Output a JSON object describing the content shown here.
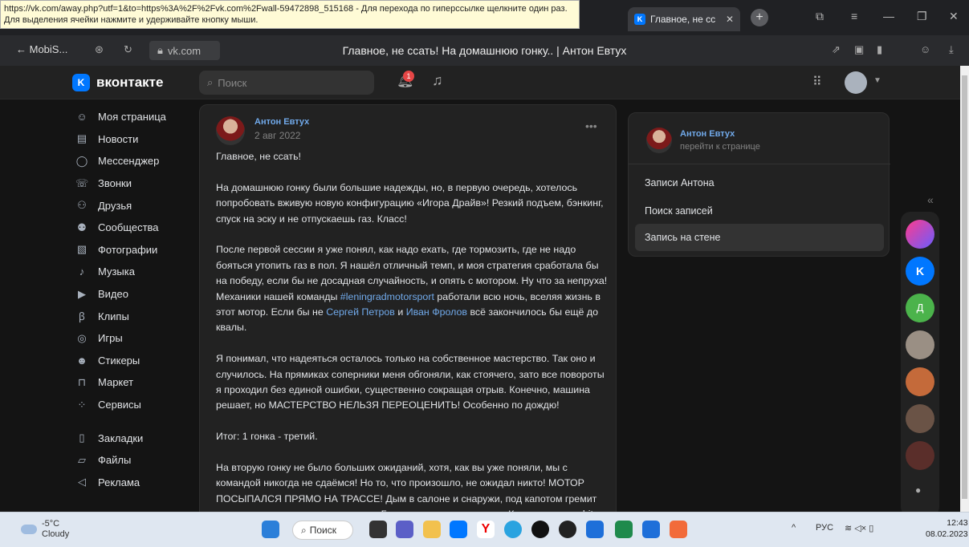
{
  "tooltip": {
    "line1": "https://vk.com/away.php?utf=1&to=https%3A%2F%2Fvk.com%2Fwall-59472898_515168 - Для перехода по гиперссылке щелкните один раз.",
    "line2": "Для выделения ячейки нажмите и удерживайте кнопку мыши."
  },
  "browser": {
    "tab_title": "Главное, не сс",
    "back_label": "MobiS...",
    "url": "vk.com",
    "page_title": "Главное, не ссать! На домашнюю гонку.. | Антон Евтух"
  },
  "vk": {
    "logo": "вконтакте",
    "search_placeholder": "Поиск",
    "notif_count": "1"
  },
  "sidebar": {
    "items": [
      {
        "label": "Моя страница",
        "icon": "user-circle-icon"
      },
      {
        "label": "Новости",
        "icon": "newspaper-icon"
      },
      {
        "label": "Мессенджер",
        "icon": "chat-icon"
      },
      {
        "label": "Звонки",
        "icon": "phone-icon"
      },
      {
        "label": "Друзья",
        "icon": "friends-icon"
      },
      {
        "label": "Сообщества",
        "icon": "groups-icon"
      },
      {
        "label": "Фотографии",
        "icon": "photo-icon"
      },
      {
        "label": "Музыка",
        "icon": "music-icon"
      },
      {
        "label": "Видео",
        "icon": "video-icon"
      },
      {
        "label": "Клипы",
        "icon": "clips-icon"
      },
      {
        "label": "Игры",
        "icon": "gamepad-icon"
      },
      {
        "label": "Стикеры",
        "icon": "sticker-icon"
      },
      {
        "label": "Маркет",
        "icon": "bag-icon"
      },
      {
        "label": "Сервисы",
        "icon": "services-icon"
      }
    ],
    "items2": [
      {
        "label": "Закладки",
        "icon": "bookmark-icon"
      },
      {
        "label": "Файлы",
        "icon": "file-icon"
      },
      {
        "label": "Реклама",
        "icon": "megaphone-icon"
      }
    ]
  },
  "post": {
    "author": "Антон Евтух",
    "date": "2 авг 2022",
    "p1": "Главное, не ссать!",
    "p2": "На домашнюю гонку были большие надежды, но, в первую очередь, хотелось попробовать вживую новую конфигурацию «Игора Драйв»! Резкий подъем, бэнкинг, спуск на эску и не отпускаешь газ. Класс!",
    "p3a": "После первой сессии я уже понял, как надо ехать, где тормозить, где не надо бояться утопить газ в пол. Я нашёл отличный темп, и моя стратегия сработала бы на победу, если бы не досадная случайность, и опять с мотором. Ну что за непруха! Механики нашей команды ",
    "p3link": "#leningradmotorsport",
    "p3b": " работали всю ночь, вселяя жизнь в этот мотор. Если бы не ",
    "p3link2": "Сергей Петров",
    "p3c": " и ",
    "p3link3": "Иван Фролов",
    "p3d": " всё закончилось бы ещё до квалы.",
    "p4": "Я понимал, что надеяться осталось только на собственное мастерство. Так оно и случилось. На прямиках соперники меня обгоняли, как стоячего, зато все повороты я проходил без единой ошибки, существенно сокращая отрыв. Конечно, машина решает, но МАСТЕРСТВО НЕЛЬЗЯ ПЕРЕОЦЕНИТЬ! Особенно по дождю!",
    "p5": "Итог: 1 гонка - третий.",
    "p6": "На вторую гонку не было больших ожиданий, хотя, как вы уже поняли, мы с командой никогда не сдаёмся! Но то, что произошло, не ожидал никто! МОТОР ПОСЫПАЛСЯ ПРЯМО НА ТРАССЕ! Дым в салоне и снаружи, под капотом гремит железками мотор, машина глохнет. Гонка для меня закончена. Как говорится, shit happens."
  },
  "right": {
    "name": "Антон Евтух",
    "sub": "перейти к странице",
    "items": [
      "Записи Антона",
      "Поиск записей",
      "Запись на стене"
    ]
  },
  "dock": {
    "letter": "Д"
  },
  "taskbar": {
    "temp": "-5°C",
    "weather": "Cloudy",
    "search": "Поиск",
    "lang": "РУС",
    "time": "12:43",
    "date": "08.02.2023"
  }
}
